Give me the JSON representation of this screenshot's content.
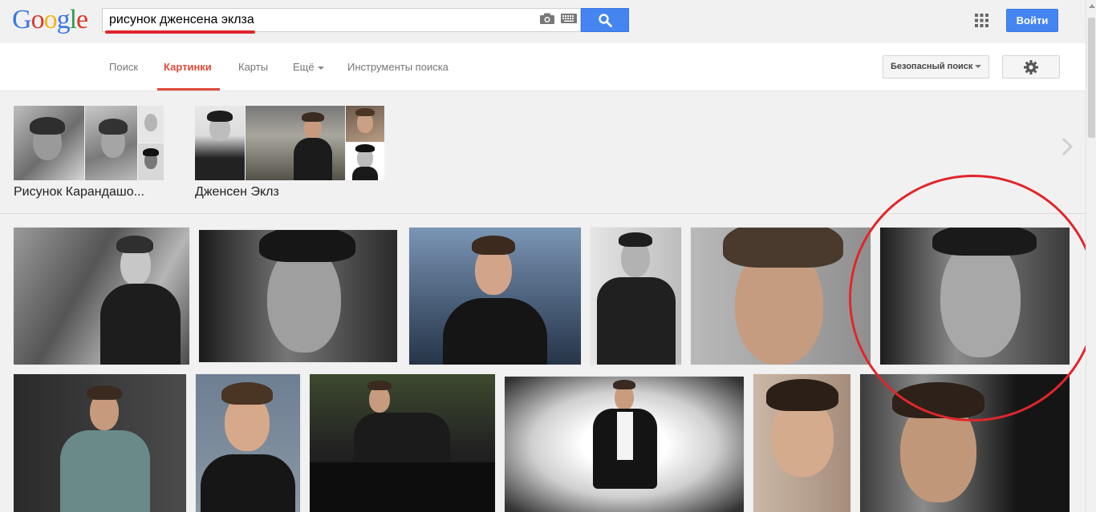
{
  "header": {
    "logo": "Google",
    "query": "рисунок дженсена эклза",
    "signin_label": "Войти"
  },
  "tabs": [
    {
      "label": "Поиск"
    },
    {
      "label": "Картинки"
    },
    {
      "label": "Карты"
    },
    {
      "label": "Ещё"
    },
    {
      "label": "Инструменты поиска"
    }
  ],
  "toolbar": {
    "safesearch_label": "Безопасный поиск"
  },
  "related": [
    {
      "label": "Рисунок Карандашо..."
    },
    {
      "label": "Дженсен Эклз"
    }
  ],
  "colors": {
    "brand_blue": "#4585f2",
    "active_tab": "#dd4b39",
    "annotation_red": "#e0262b"
  },
  "icons": [
    "camera-icon",
    "keyboard-icon",
    "search-icon",
    "apps-grid-icon",
    "gear-icon",
    "chevron-right-icon",
    "dropdown-arrow-icon"
  ]
}
